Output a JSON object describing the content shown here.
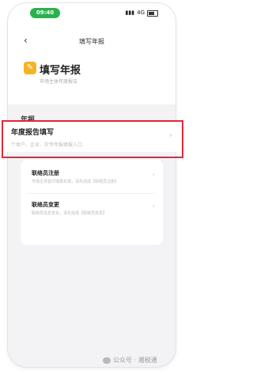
{
  "status_bar": {
    "time": "09:40",
    "signal": "4G"
  },
  "nav": {
    "title": "填写年报"
  },
  "hero": {
    "title": "填写年报",
    "subtitle": "市场主体年度报告"
  },
  "section": {
    "label": "年报"
  },
  "items": [
    {
      "title": "年度报告填写",
      "desc": "个体户、企业、农专年报填报入口"
    },
    {
      "title": "联络员注册",
      "desc": "市场主体首次填报年报，请先完成【联络员注册】"
    },
    {
      "title": "联络员变更",
      "desc": "联络员信息变化，请先完成【联络员变更】"
    }
  ],
  "watermark": {
    "text": "公众号 · 湘税通"
  },
  "colors": {
    "accent": "#2bb24c",
    "highlight": "#e0283a",
    "icon": "#f5b324"
  }
}
